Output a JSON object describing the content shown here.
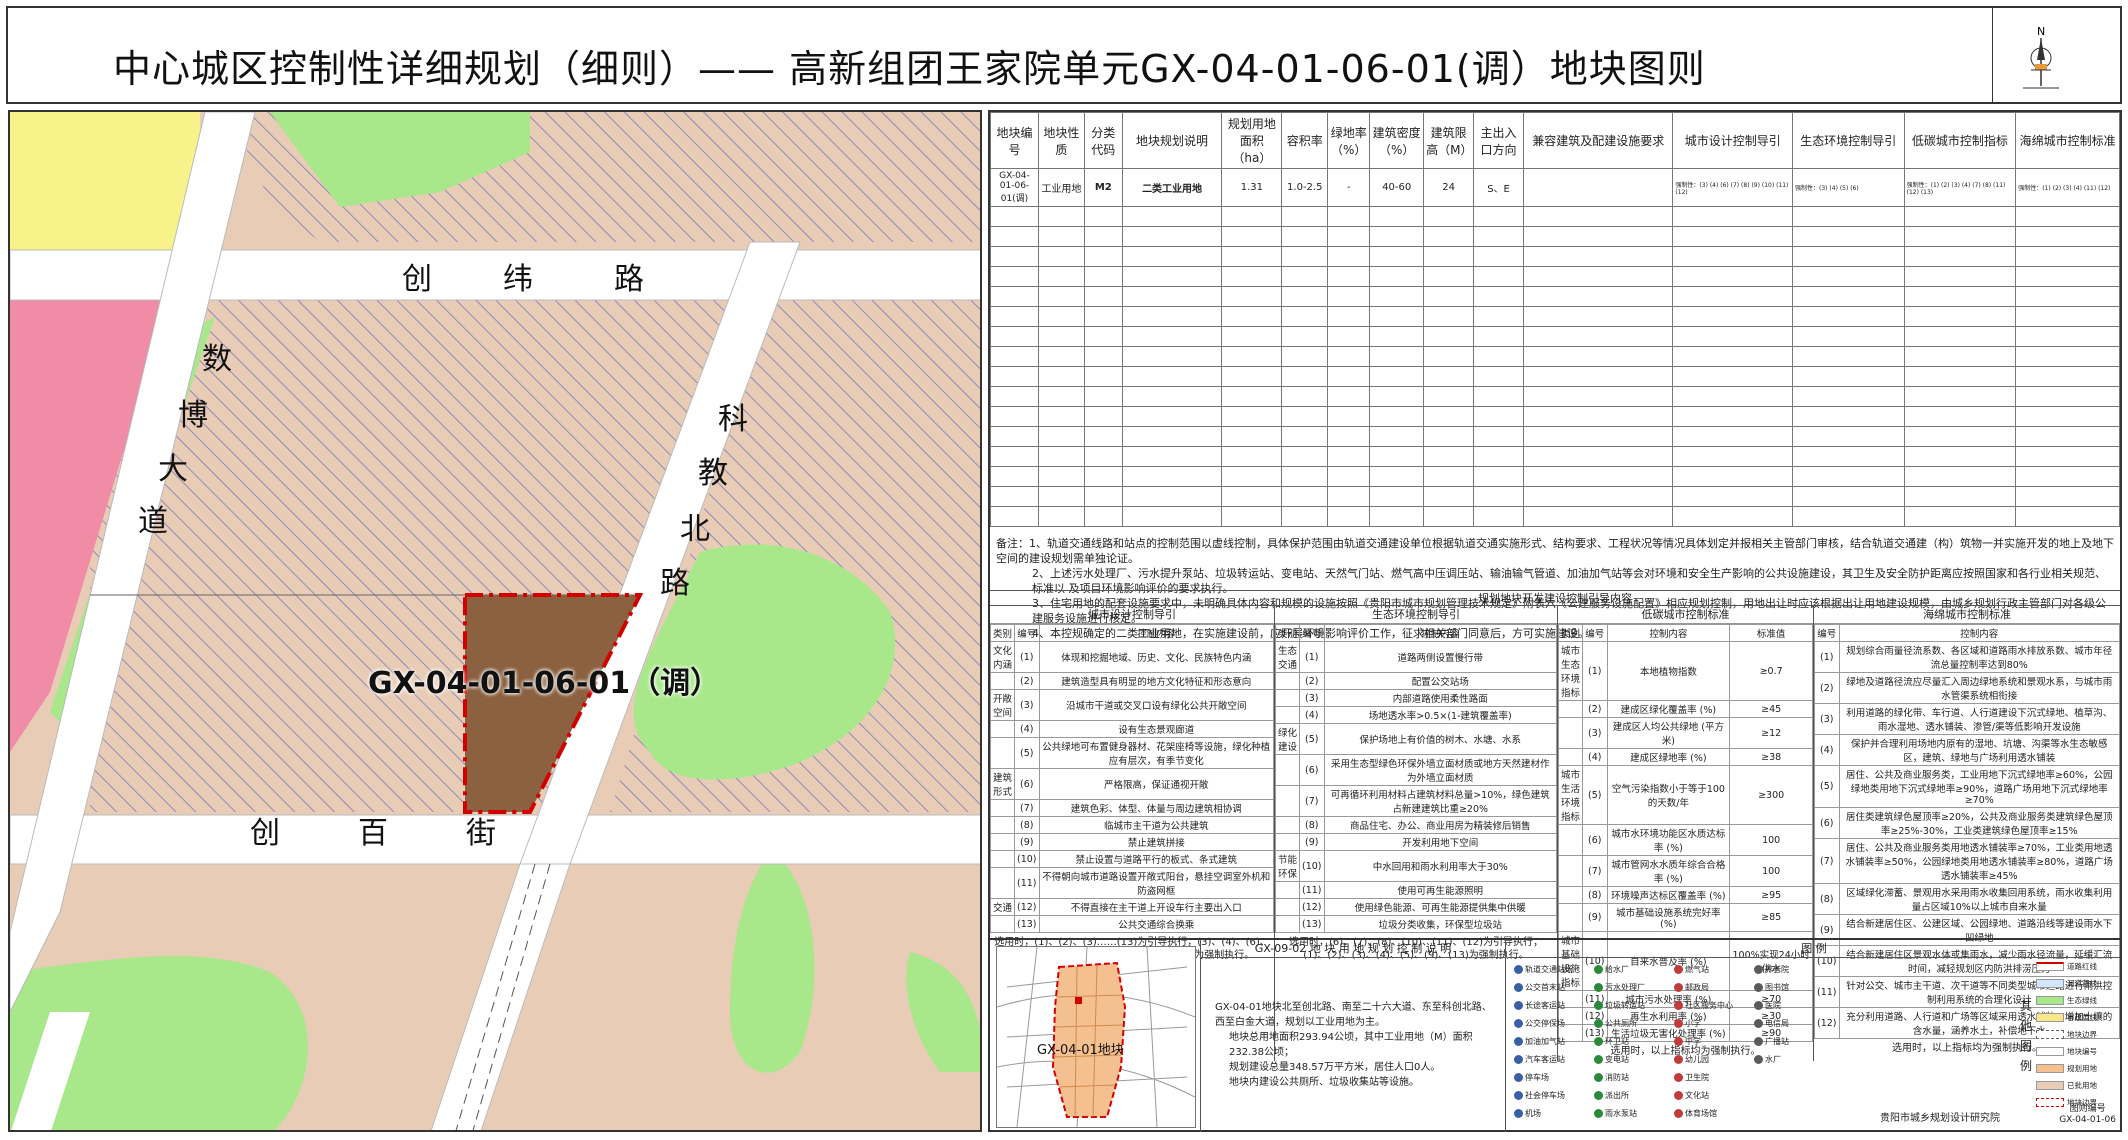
{
  "header": {
    "title": "中心城区控制性详细规划（细则）——  高新组团王家院单元GX-04-01-06-01(调）地块图则",
    "north": "N"
  },
  "map": {
    "roads": [
      "创",
      "纬",
      "路",
      "数",
      "博",
      "大",
      "道",
      "科",
      "教",
      "北",
      "路",
      "创",
      "百",
      "街"
    ],
    "parcel_label": "GX-04-01-06-01（调）",
    "colors": {
      "parcel": "#8b6140",
      "parcel_border": "#d40000",
      "green": "#a8e88a",
      "industrial_hatch": "#7a7ab8",
      "pink": "#f08ca6",
      "yellow": "#f7f28a",
      "road": "#ffffff",
      "base": "#e8ccb6"
    }
  },
  "main_table": {
    "headers": [
      "地块编号",
      "地块性质",
      "分类代码",
      "地块规划说明",
      "规划用地面积（ha）",
      "容积率",
      "绿地率（%）",
      "建筑密度（%）",
      "建筑限高（M）",
      "主出入口方向",
      "兼容建筑及配建设施要求",
      "城市设计控制导引",
      "生态环境控制导引",
      "低碳城市控制指标",
      "海绵城市控制标准"
    ],
    "row": [
      "GX-04-01-06-01(调)",
      "工业用地",
      "M2",
      "二类工业用地",
      "1.31",
      "1.0-2.5",
      "-",
      "40-60",
      "24",
      "S、E",
      "",
      "强制性：(3) (4) (6) (7) (8) (9) (10) (11) (12)",
      "强制性：(3) (4) (5) (6)",
      "强制性：(1) (2) (3) (4) (7) (8) (11) (12) (13)",
      "强制性：(1) (2) (3) (4) (11) (12)"
    ]
  },
  "notes": [
    "备注：1、轨道交通线路和站点的控制范围以虚线控制，具体保护范围由轨道交通建设单位根据轨道交通实施形式、结构要求、工程状况等情况具体划定并报相关主管部门审核，结合轨道交通建（构）筑物一并实施开发的地上及地下空间的建设规划需单独论证。",
    "2、上述污水处理厂、污水提升泵站、垃圾转运站、变电站、天然气门站、燃气高中压调压站、输油输气管道、加油加气站等会对环境和安全生产影响的公共设施建设，其卫生及安全防护距离应按照国家和各行业相关规范、标准以  及项目环境影响评价的要求执行。",
    "3、住宅用地的配套设施要求中，未明确具体内容和规模的设施按照《贵阳市城市规划管理技术规定》附表六《公建服务设施配置》相应规划控制，用地出让时应该根据出让用地建设规模，由城乡规划行政主管部门对各级公建服务设施进行核定。",
    "4、本控规确定的二类工业用地，在实施建设前，应开展环境影响评价工作，征求相关部门同意后，方可实施建设。"
  ],
  "guide": {
    "title": "规划地块开发建设控制引导内容",
    "columns": [
      {
        "title": "城市设计控制导引",
        "headers": [
          "类别",
          "编号",
          "控制内容"
        ],
        "rows": [
          [
            "文化内涵",
            "(1)",
            "体现和挖掘地域、历史、文化、民族特色内涵"
          ],
          [
            "",
            "(2)",
            "建筑造型具有明显的地方文化特征和形态意向"
          ],
          [
            "开敞空间",
            "(3)",
            "沿城市干道或交叉口设有绿化公共开敞空间"
          ],
          [
            "",
            "(4)",
            "设有生态景观廊道"
          ],
          [
            "",
            "(5)",
            "公共绿地可布置健身器材、花架座椅等设施，绿化种植应有层次，有季节变化"
          ],
          [
            "建筑形式",
            "(6)",
            "严格限高，保证通视开敞"
          ],
          [
            "",
            "(7)",
            "建筑色彩、体型、体量与周边建筑相协调"
          ],
          [
            "",
            "(8)",
            "临城市主干道为公共建筑"
          ],
          [
            "",
            "(9)",
            "禁止建筑拼接"
          ],
          [
            "",
            "(10)",
            "禁止设置与道路平行的板式、条式建筑"
          ],
          [
            "",
            "(11)",
            "不得朝向城市道路设置开敞式阳台，悬挂空调室外机和防盗网框"
          ],
          [
            "交通",
            "(12)",
            "不得直接在主干道上开设车行主要出入口"
          ],
          [
            "",
            "(13)",
            "公共交通综合换乘"
          ]
        ],
        "footer": "选用时，(1)、(2)、(3)……(13)为引导执行，(3)、(4)、(6)、(7)、(8)、(9)、(10)、(11)、(12)、(13)为强制执行。"
      },
      {
        "title": "生态环境控制导引",
        "headers": [
          "类别",
          "编号",
          "控制内容"
        ],
        "rows": [
          [
            "生态交通",
            "(1)",
            "道路两侧设置慢行带"
          ],
          [
            "",
            "(2)",
            "配置公交站场"
          ],
          [
            "",
            "(3)",
            "内部道路使用柔性路面"
          ],
          [
            "",
            "(4)",
            "场地透水率>0.5×(1-建筑覆盖率)"
          ],
          [
            "绿化建设",
            "(5)",
            "保护场地上有价值的树木、水塘、水系"
          ],
          [
            "",
            "(6)",
            "采用生态型绿色环保外墙立面材质或地方天然建材作为外墙立面材质"
          ],
          [
            "",
            "(7)",
            "可再循环利用材料占建筑材料总量>10%，绿色建筑占新建建筑比重≥20%"
          ],
          [
            "",
            "(8)",
            "商品住宅、办公、商业用房为精装修后销售"
          ],
          [
            "",
            "(9)",
            "开发利用地下空间"
          ],
          [
            "节能环保",
            "(10)",
            "中水回用和雨水利用率大于30%"
          ],
          [
            "",
            "(11)",
            "使用可再生能源照明"
          ],
          [
            "",
            "(12)",
            "使用绿色能源、可再生能源提供集中供暖"
          ],
          [
            "",
            "(13)",
            "垃圾分类收集，环保型垃圾站"
          ]
        ],
        "footer": "选用时，(6)、(7)、(8)、(10)、(11)、(12)为引导执行；(1)、(2)、(3)、(4)、(5)、(9)、(13)为强制执行。"
      },
      {
        "title": "低碳城市控制标准",
        "headers": [
          "类别",
          "编号",
          "控制内容",
          "标准值"
        ],
        "rows": [
          [
            "城市生态环境指标",
            "(1)",
            "本地植物指数",
            "≥0.7"
          ],
          [
            "",
            "(2)",
            "建成区绿化覆盖率 (%)",
            "≥45"
          ],
          [
            "",
            "(3)",
            "建成区人均公共绿地 (平方米)",
            "≥12"
          ],
          [
            "",
            "(4)",
            "建成区绿地率 (%)",
            "≥38"
          ],
          [
            "城市生活环境指标",
            "(5)",
            "空气污染指数小于等于100的天数/年",
            "≥300"
          ],
          [
            "",
            "(6)",
            "城市水环境功能区水质达标率 (%)",
            "100"
          ],
          [
            "",
            "(7)",
            "城市管网水水质年综合合格率 (%)",
            "100"
          ],
          [
            "",
            "(8)",
            "环境噪声达标区覆盖率 (%)",
            "≥95"
          ],
          [
            "",
            "(9)",
            "城市基础设施系统完好率 (%)",
            "≥85"
          ],
          [
            "城市基础设施指标",
            "(10)",
            "自来水普及率 (%)",
            "100%实现24小时供水"
          ],
          [
            "",
            "(11)",
            "城市污水处理率 (%)",
            "≥70"
          ],
          [
            "",
            "(12)",
            "再生水利用率 (%)",
            "≥30"
          ],
          [
            "",
            "(13)",
            "生活垃圾无害化处理率 (%)",
            "≥90"
          ]
        ],
        "footer": "选用时，以上指标均为强制执行。"
      },
      {
        "title": "海绵城市控制标准",
        "headers": [
          "编号",
          "控制内容"
        ],
        "rows": [
          [
            "(1)",
            "规划综合雨量径流系数、各区域和道路雨水排放系数、城市年径流总量控制率达到80%"
          ],
          [
            "(2)",
            "绿地及道路径流应尽量汇入周边绿地系统和景观水系，与城市雨水管渠系统相衔接"
          ],
          [
            "(3)",
            "利用道路的绿化带、车行道、人行道建设下沉式绿地、植草沟、雨水湿地、透水铺装、渗管/渠等低影响开发设施"
          ],
          [
            "(4)",
            "保护并合理利用场地内原有的湿地、坑塘、沟渠等水生态敏感区，建筑、绿地与广场利用透水铺装"
          ],
          [
            "(5)",
            "居住、公共及商业服务类，工业用地下沉式绿地率≥60%，公园绿地类用地下沉式绿地率≥90%，道路广场用地下沉式绿地率≥70%"
          ],
          [
            "(6)",
            "居住类建筑绿色屋顶率≥20%，公共及商业服务类建筑绿色屋顶率≥25%-30%，工业类建筑绿色屋顶率≥15%"
          ],
          [
            "(7)",
            "居住、公共及商业服务类用地透水铺装率≥70%，工业类用地透水铺装率≥50%，公园绿地类用地透水铺装率≥80%，道路广场透水铺装率≥45%"
          ],
          [
            "(8)",
            "区域绿化滞蓄、景观用水采用雨水收集回用系统，雨水收集利用量占区域10%以上城市自来水量"
          ],
          [
            "(9)",
            "结合新建居住区、公建区域、公园绿地、道路沿线等建设雨水下凹绿地"
          ],
          [
            "(10)",
            "结合新建居住区景观水体或集雨水，减少雨水径流量，延缓汇流时间，减轻规划区内防洪排涝压力"
          ],
          [
            "(11)",
            "针对公交、城市主干道、次干道等不同类型城市道路进行雨洪控制利用系统的合理化设计"
          ],
          [
            "(12)",
            "充分利用道路、人行道和广场等区域采用透水铺装，增加土壤的含水量，涵养水土，补偿地下水"
          ]
        ],
        "footer": "选用时，以上指标均为强制执行。"
      }
    ]
  },
  "bottom": {
    "inset_label": "GX-04-01地块",
    "plan_desc_title": "GX-09-02 地 块 用 地 规 划 控 制 说 明",
    "plan_desc_lines": [
      "GX-04-01地块北至创北路、南至二十六大道、东至科创北路、西至白金大道，规划以工业用地为主。",
      "地块总用地面积293.94公顷，其中工业用地（M）面积232.38公顷；",
      "规划建设总量348.57万平方米，居住人口0人。",
      "地块内建设公共厕所、垃圾收集站等设施。"
    ],
    "legend_title": "图    例",
    "legend_items": [
      "轨道交通站场",
      "公交首末站",
      "长途客运站",
      "公交停保场",
      "加油加气站",
      "汽车客运站",
      "停车场",
      "社会停车场",
      "机场",
      "给水厂",
      "污水处理厂",
      "垃圾转运站",
      "公共厕所",
      "环卫站",
      "变电站",
      "消防站",
      "派出所",
      "雨水泵站",
      "燃气站",
      "邮政局",
      "社区服务中心",
      "小学",
      "中学",
      "幼儿园",
      "卫生院",
      "文化站",
      "体育场馆",
      "养老院",
      "图书馆",
      "医院",
      "电信局",
      "广播站",
      "水厂"
    ],
    "line_legend": [
      "道路红线",
      "河道蓝线",
      "生态绿线",
      "市政黄线",
      "地块边界",
      "地块编号",
      "规划用地",
      "已批用地",
      "地块边界"
    ],
    "other_legend": "其他图例",
    "org": "贵阳市城乡规划设计研究院",
    "code_label": "图则编号",
    "code_value": "GX-04-01-06"
  }
}
